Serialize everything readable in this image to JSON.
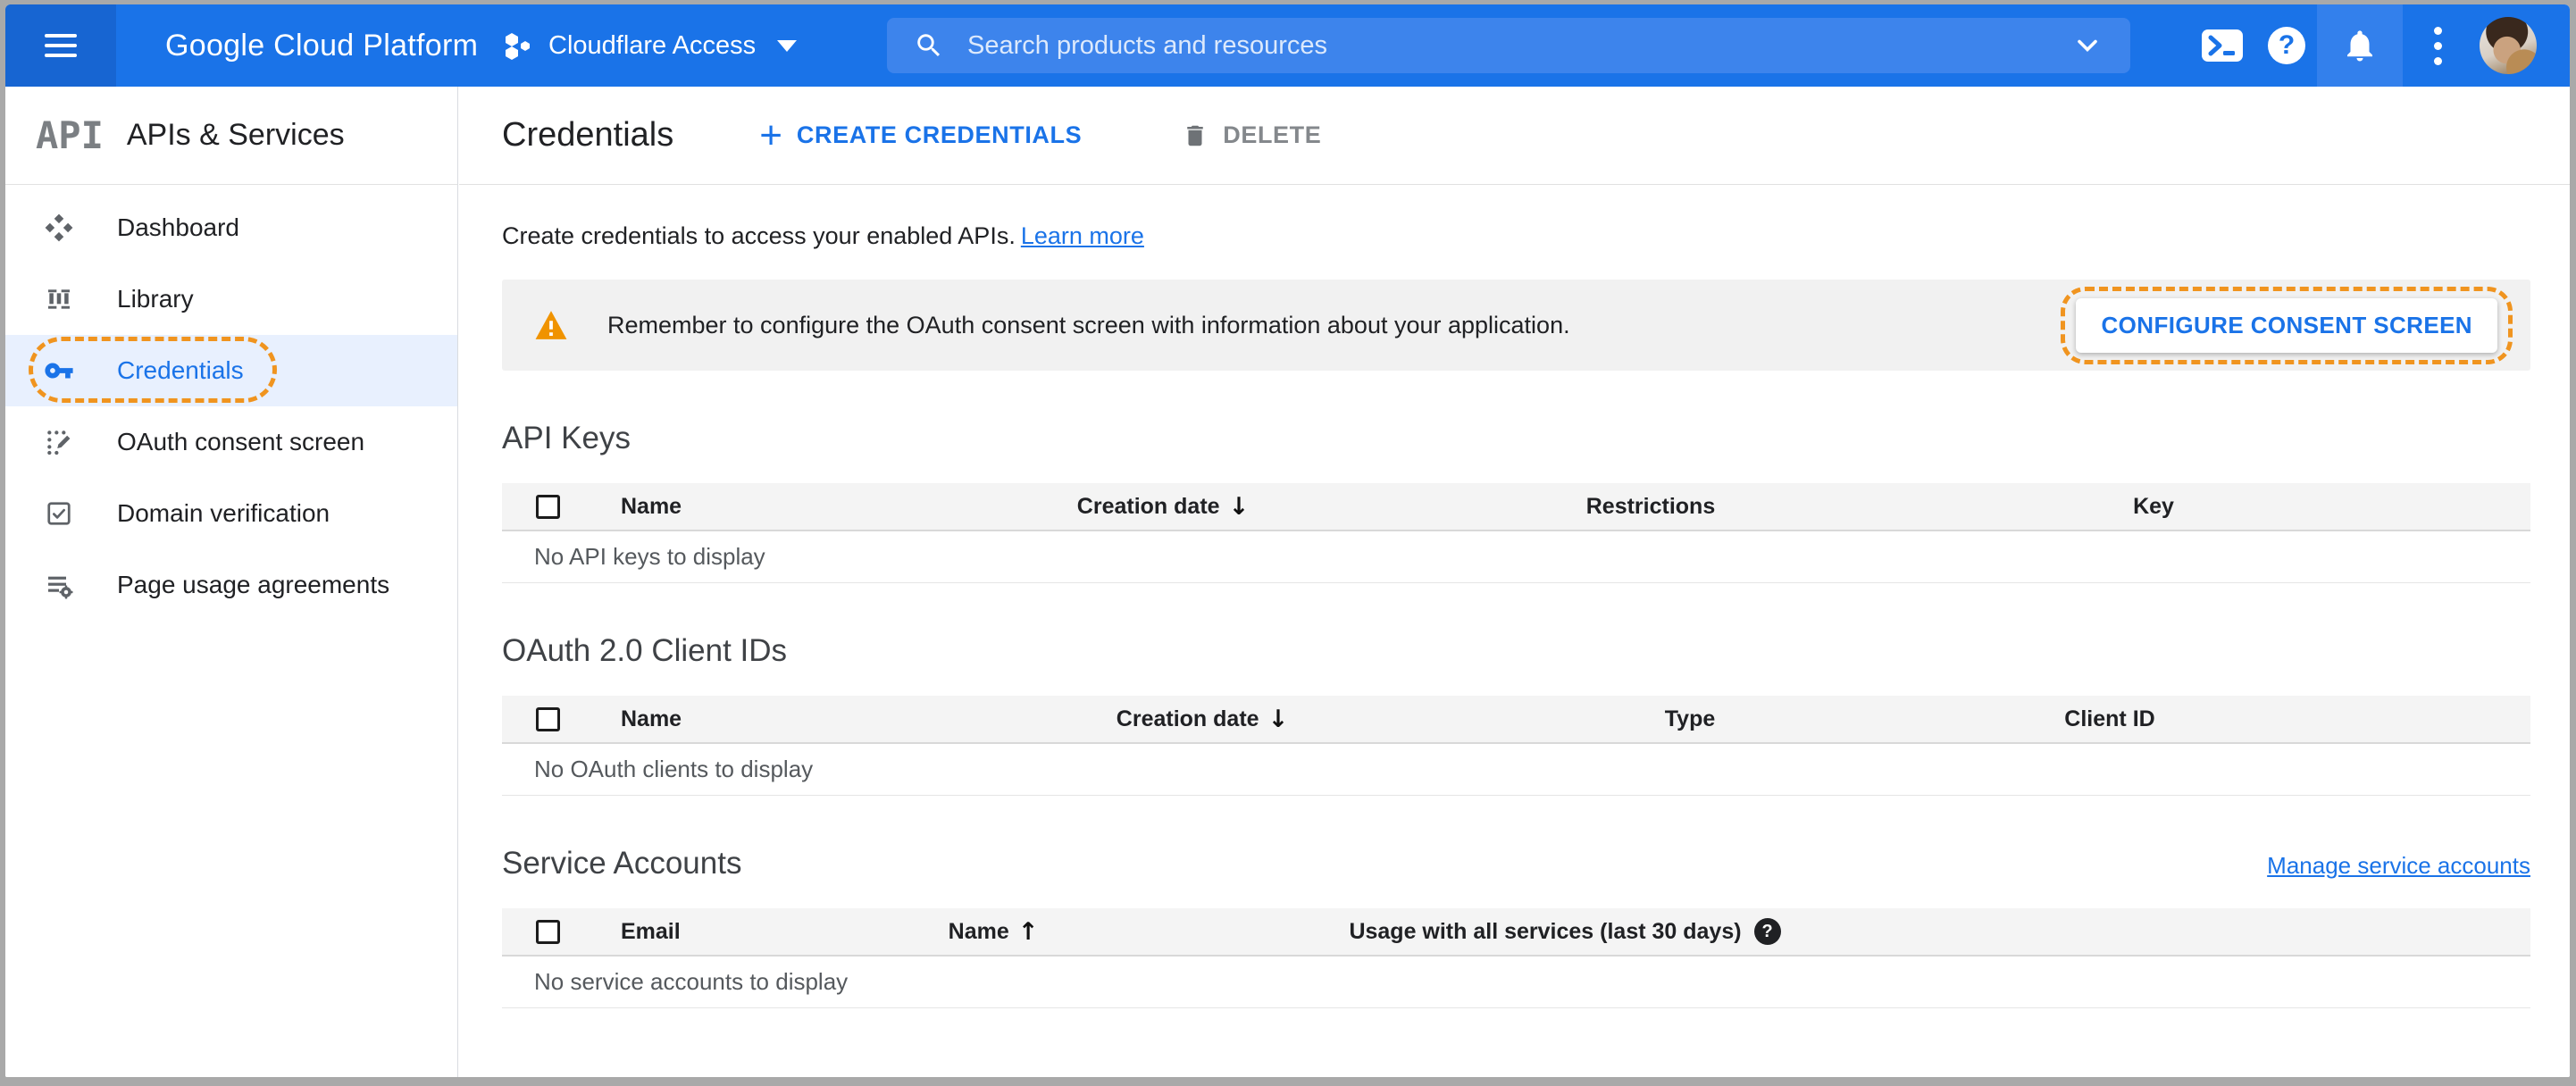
{
  "glyphs": {
    "sort_desc": "↓",
    "sort_asc": "↑",
    "help_q": "?",
    "plus": "+"
  },
  "colors": {
    "topbar_blue": "#1a73e8",
    "topbar_menu_blue": "#1765d2",
    "search_bg": "#3d84ec",
    "accent_blue": "#1a73e8",
    "active_item_bg": "#e8f0fe",
    "highlight_orange": "#f0941f",
    "warning_orange": "#f09300",
    "banner_bg": "#f1f1f1",
    "table_header_bg": "#f4f4f4"
  },
  "topbar": {
    "logo": "Google Cloud Platform",
    "project_selector": {
      "label": "Cloudflare Access",
      "icon": "project-hexagons-icon",
      "caret": "caret-down-icon"
    },
    "search": {
      "placeholder": "Search products and resources",
      "icon": "search-icon",
      "chevron": "chevron-down-icon"
    },
    "actions": {
      "cloud_shell": "cloud-shell-icon",
      "help": "help-icon",
      "notifications": "notifications-bell-icon",
      "more": "kebab-menu-icon",
      "avatar": "user-avatar"
    }
  },
  "sidebar": {
    "logo_text": "API",
    "title": "APIs & Services",
    "items": [
      {
        "label": "Dashboard",
        "icon": "dashboard-icon",
        "active": false
      },
      {
        "label": "Library",
        "icon": "library-icon",
        "active": false
      },
      {
        "label": "Credentials",
        "icon": "key-icon",
        "active": true,
        "highlighted": true
      },
      {
        "label": "OAuth consent screen",
        "icon": "consent-screen-icon",
        "active": false
      },
      {
        "label": "Domain verification",
        "icon": "domain-verification-icon",
        "active": false
      },
      {
        "label": "Page usage agreements",
        "icon": "page-usage-icon",
        "active": false
      }
    ]
  },
  "header": {
    "title": "Credentials",
    "create_button": "CREATE CREDENTIALS",
    "delete_button": "DELETE"
  },
  "intro": {
    "text": "Create credentials to access your enabled APIs.",
    "link": "Learn more"
  },
  "banner": {
    "text": "Remember to configure the OAuth consent screen with information about your application.",
    "button": "CONFIGURE CONSENT SCREEN",
    "highlighted": true
  },
  "sections": {
    "api_keys": {
      "title": "API Keys",
      "columns": [
        "Name",
        "Creation date",
        "Restrictions",
        "Key"
      ],
      "sort": {
        "column": "Creation date",
        "direction": "desc"
      },
      "empty": "No API keys to display"
    },
    "oauth_clients": {
      "title": "OAuth 2.0 Client IDs",
      "columns": [
        "Name",
        "Creation date",
        "Type",
        "Client ID"
      ],
      "sort": {
        "column": "Creation date",
        "direction": "desc"
      },
      "empty": "No OAuth clients to display"
    },
    "service_accounts": {
      "title": "Service Accounts",
      "link": "Manage service accounts",
      "columns": [
        "Email",
        "Name",
        "Usage with all services (last 30 days)"
      ],
      "sort": {
        "column": "Name",
        "direction": "asc"
      },
      "empty": "No service accounts to display"
    }
  }
}
